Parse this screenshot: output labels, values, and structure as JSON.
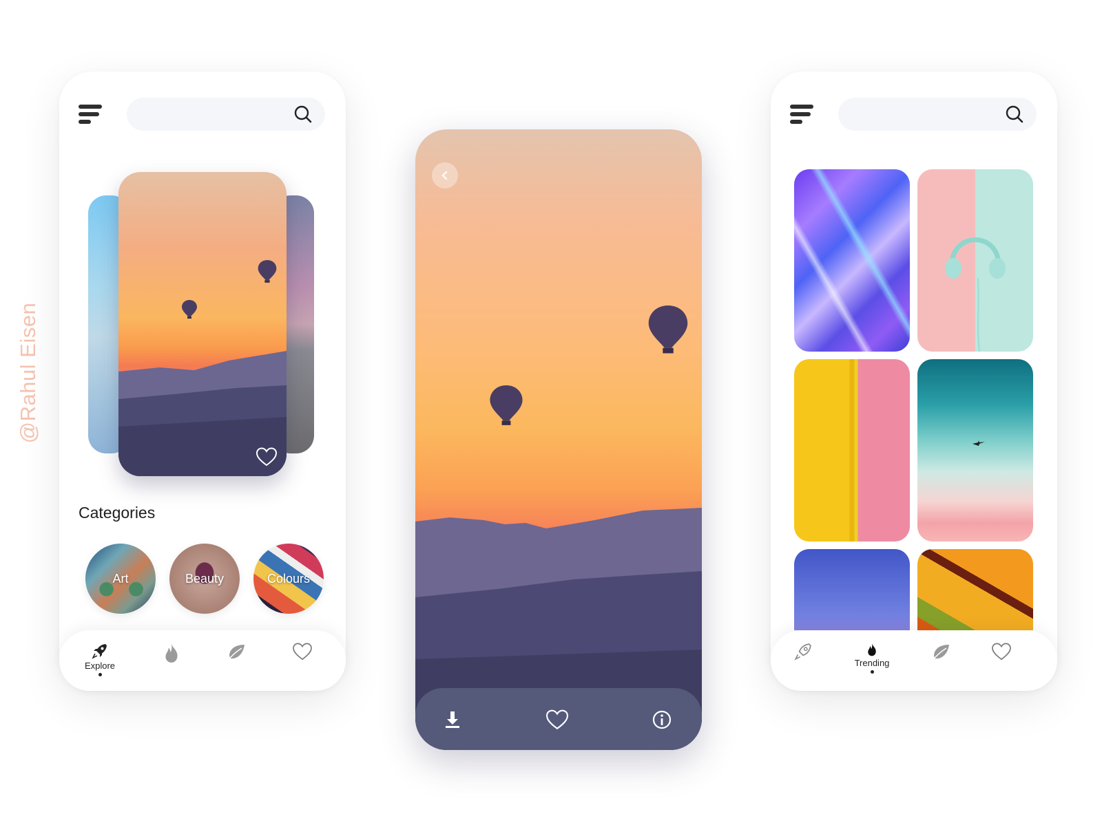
{
  "watermark": "@Rahul Eisen",
  "left_phone": {
    "search": {
      "placeholder": "",
      "value": ""
    },
    "categories_title": "Categories",
    "categories": [
      {
        "label": "Art"
      },
      {
        "label": "Beauty"
      },
      {
        "label": "Colours"
      }
    ],
    "nav": [
      {
        "label": "Explore",
        "icon": "rocket-icon",
        "active": true
      },
      {
        "label": "",
        "icon": "flame-icon",
        "active": false
      },
      {
        "label": "",
        "icon": "leaf-icon",
        "active": false
      },
      {
        "label": "",
        "icon": "heart-icon",
        "active": false
      }
    ]
  },
  "center_phone": {
    "actions": [
      {
        "icon": "download-icon"
      },
      {
        "icon": "heart-icon"
      },
      {
        "icon": "info-icon"
      }
    ]
  },
  "right_phone": {
    "search": {
      "placeholder": "",
      "value": ""
    },
    "tiles": [
      {
        "subject": "holographic-abstract"
      },
      {
        "subject": "headphones-pastel"
      },
      {
        "subject": "yellow-pink-wall"
      },
      {
        "subject": "teal-pink-sky-bird"
      },
      {
        "subject": "purple-sky-clouds"
      },
      {
        "subject": "orange-mosaic"
      }
    ],
    "nav": [
      {
        "label": "",
        "icon": "rocket-icon",
        "active": false
      },
      {
        "label": "Trending",
        "icon": "flame-icon",
        "active": true
      },
      {
        "label": "",
        "icon": "leaf-icon",
        "active": false
      },
      {
        "label": "",
        "icon": "heart-icon",
        "active": false
      }
    ]
  },
  "colors": {
    "accent_dark": "#222222",
    "search_bg": "#f4f6f9",
    "watermark": "#f6c3b0",
    "action_bar": "#585e7e"
  }
}
